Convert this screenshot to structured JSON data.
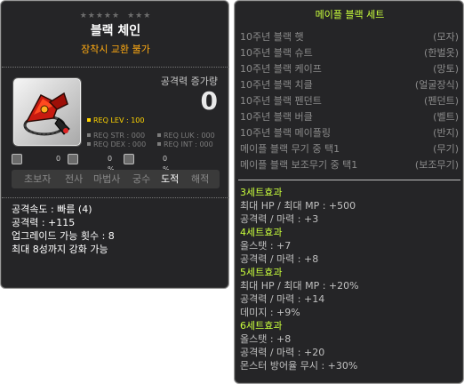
{
  "item": {
    "stars_group1": "★★★★★",
    "stars_group2": "★★★",
    "name": "블랙 체인",
    "untradable": "장착시 교환 불가",
    "attack_increase_label": "공격력 증가량",
    "attack_increase_value": "0",
    "requirements": {
      "level": "REQ LEV : 100",
      "str": "REQ STR : 000",
      "luk": "REQ LUK : 000",
      "dex": "REQ DEX : 000",
      "int": "REQ INT : 000"
    },
    "properties": [
      "0",
      "0 %",
      "0 %"
    ],
    "jobs": [
      "초보자",
      "전사",
      "마법사",
      "궁수",
      "도적",
      "해적"
    ],
    "active_job": "도적",
    "stats": [
      "공격속도 : 빠름 (4)",
      "공격력 : +115",
      "업그레이드 가능 횟수 : 8",
      "최대 8성까지 강화 가능"
    ],
    "colors": {
      "name": "#ffffff",
      "untradable": "#ffaa11",
      "req_level": "#ffd400",
      "set_accent": "#c9ff3c"
    }
  },
  "set": {
    "title": "메이플 블랙 세트",
    "items": [
      {
        "name": "10주년 블랙 햇",
        "part": "(모자)"
      },
      {
        "name": "10주년 블랙 슈트",
        "part": "(한벌옷)"
      },
      {
        "name": "10주년 블랙 케이프",
        "part": "(망토)"
      },
      {
        "name": "10주년 블랙 치클",
        "part": "(얼굴장식)"
      },
      {
        "name": "10주년 블랙 펜던트",
        "part": "(펜던트)"
      },
      {
        "name": "10주년 블랙 버클",
        "part": "(벨트)"
      },
      {
        "name": "10주년 블랙 메이플링",
        "part": "(반지)"
      },
      {
        "name": "메이플 블랙 무기 중 택1",
        "part": "(무기)"
      },
      {
        "name": "메이플 블랙 보조무기 중 택1",
        "part": "(보조무기)"
      }
    ],
    "effects": [
      {
        "title": "3세트효과",
        "lines": [
          "최대 HP / 최대 MP : +500",
          "공격력 / 마력 : +3"
        ]
      },
      {
        "title": "4세트효과",
        "lines": [
          "올스탯 : +7",
          "공격력 / 마력 : +8"
        ]
      },
      {
        "title": "5세트효과",
        "lines": [
          "최대 HP / 최대 MP : +20%",
          "공격력 / 마력 : +14",
          "데미지 : +9%"
        ]
      },
      {
        "title": "6세트효과",
        "lines": [
          "올스탯 : +8",
          "공격력 / 마력 : +20",
          "몬스터 방어율 무시 : +30%"
        ]
      }
    ]
  }
}
